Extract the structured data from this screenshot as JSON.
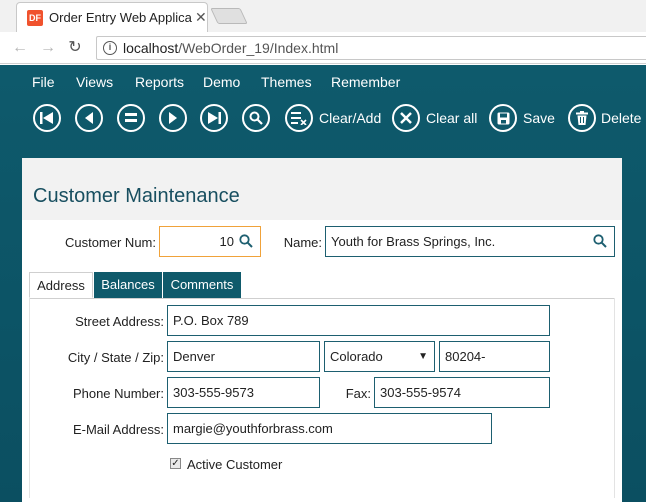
{
  "browser": {
    "tab_title": "Order Entry Web Applica",
    "favicon_text": "DF",
    "url_host": "localhost",
    "url_path": "/WebOrder_19/Index.html"
  },
  "menu": {
    "items": [
      {
        "label": "File"
      },
      {
        "label": "Views"
      },
      {
        "label": "Reports"
      },
      {
        "label": "Demo"
      },
      {
        "label": "Themes"
      },
      {
        "label": "Remember"
      }
    ]
  },
  "toolbar": {
    "clear_add_label": "Clear/Add",
    "clear_all_label": "Clear all",
    "save_label": "Save",
    "delete_label": "Delete"
  },
  "panel": {
    "title": "Customer Maintenance",
    "customer_num_label": "Customer Num:",
    "customer_num_value": "10",
    "name_label": "Name:",
    "name_value": "Youth for Brass Springs, Inc."
  },
  "tabs": [
    {
      "label": "Address",
      "active": true
    },
    {
      "label": "Balances",
      "active": false
    },
    {
      "label": "Comments",
      "active": false
    }
  ],
  "address": {
    "street_label": "Street Address:",
    "street_value": "P.O. Box 789",
    "city_state_zip_label": "City / State / Zip:",
    "city_value": "Denver",
    "state_value": "Colorado",
    "zip_value": "80204-",
    "phone_label": "Phone Number:",
    "phone_value": "303-555-9573",
    "fax_label": "Fax:",
    "fax_value": "303-555-9574",
    "email_label": "E-Mail Address:",
    "email_value": "margie@youthforbrass.com",
    "active_label": "Active Customer",
    "active_checked": true
  },
  "colors": {
    "app_background": "#0e5a6c",
    "focus_border": "#f0a23a",
    "field_border": "#1d5f70"
  }
}
